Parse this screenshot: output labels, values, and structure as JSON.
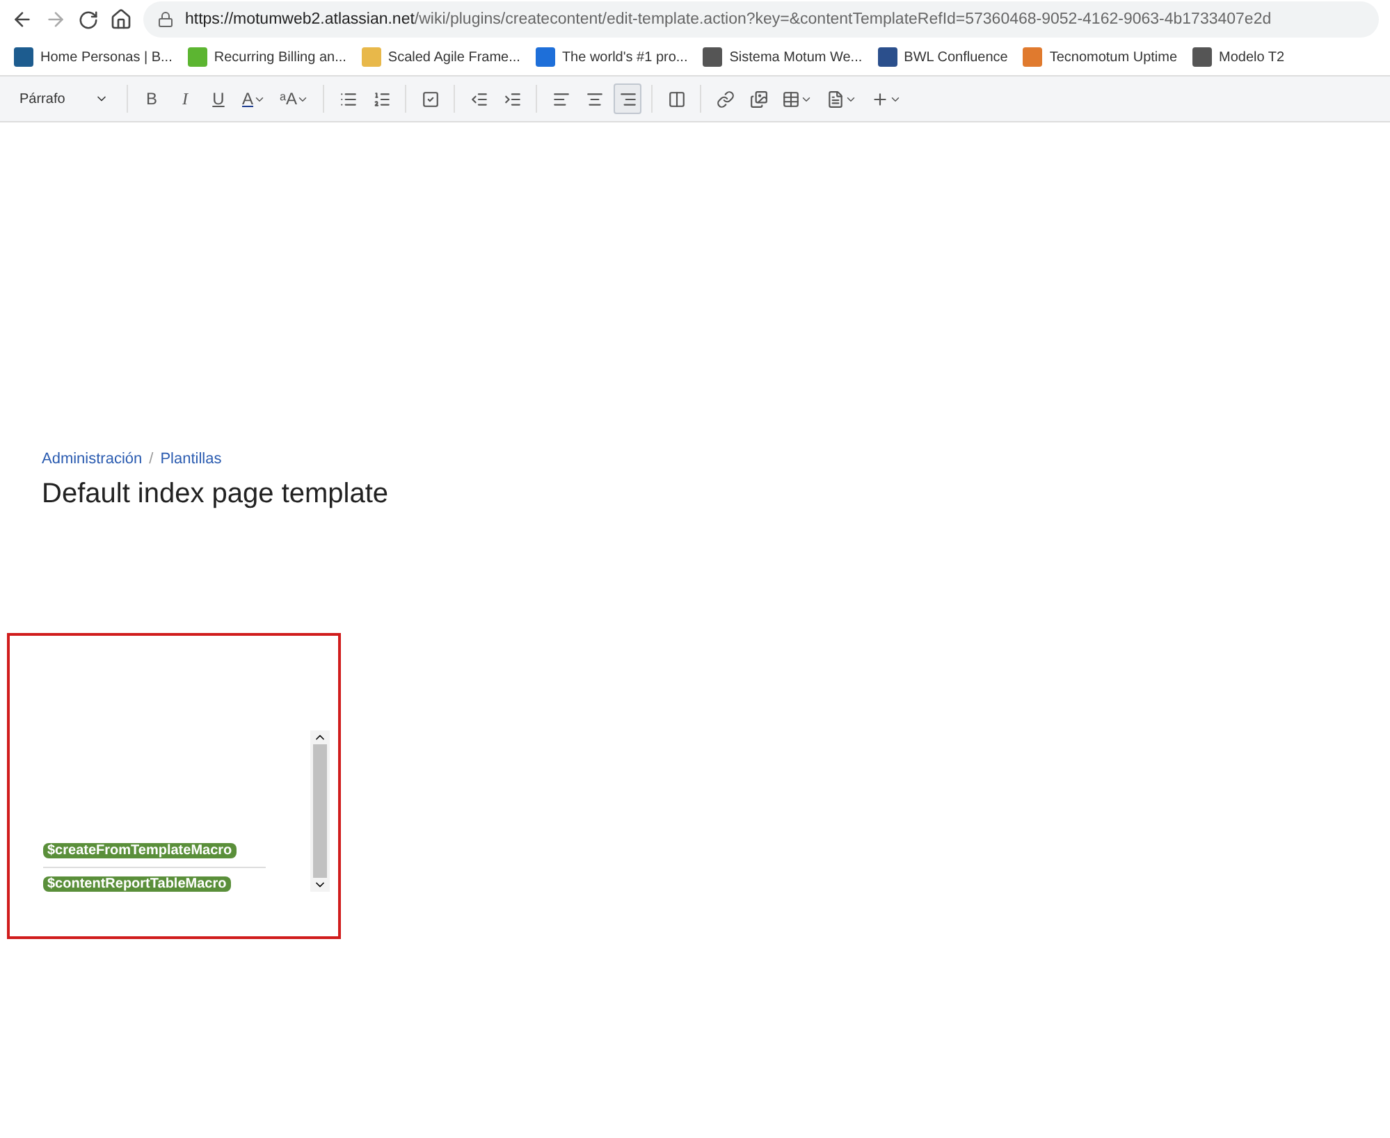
{
  "browser": {
    "url_host": "https://motumweb2.atlassian.net",
    "url_path": "/wiki/plugins/createcontent/edit-template.action?key=&contentTemplateRefId=57360468-9052-4162-9063-4b1733407e2d"
  },
  "bookmarks": [
    {
      "label": "Home Personas | B...",
      "color": "#1d5c8f"
    },
    {
      "label": "Recurring Billing an...",
      "color": "#5cb531"
    },
    {
      "label": "Scaled Agile Frame...",
      "color": "#e8b84a"
    },
    {
      "label": "The world's #1 pro...",
      "color": "#1e6fd9"
    },
    {
      "label": "Sistema Motum We...",
      "color": "#555555"
    },
    {
      "label": "BWL Confluence",
      "color": "#2b4f8c"
    },
    {
      "label": "Tecnomotum Uptime",
      "color": "#e07a2e"
    },
    {
      "label": "Modelo T2",
      "color": "#555555"
    }
  ],
  "toolbar": {
    "paragraph_style": "Párrafo",
    "buttons": [
      {
        "kind": "bold",
        "label": "B",
        "selected": false
      },
      {
        "kind": "italic",
        "label": "I",
        "selected": false
      },
      {
        "kind": "underline",
        "label": "U",
        "selected": false
      },
      {
        "kind": "color",
        "label": "A",
        "selected": false
      },
      {
        "kind": "format",
        "label": "ᵃA",
        "selected": false
      },
      {
        "kind": "sep"
      },
      {
        "kind": "bullets",
        "selected": false
      },
      {
        "kind": "numbers",
        "selected": false
      },
      {
        "kind": "sep"
      },
      {
        "kind": "task",
        "selected": false
      },
      {
        "kind": "sep"
      },
      {
        "kind": "outdent",
        "selected": false
      },
      {
        "kind": "indent",
        "selected": false
      },
      {
        "kind": "sep"
      },
      {
        "kind": "align-left",
        "selected": false
      },
      {
        "kind": "align-center",
        "selected": false
      },
      {
        "kind": "align-right",
        "selected": true
      },
      {
        "kind": "sep"
      },
      {
        "kind": "layout",
        "selected": false
      },
      {
        "kind": "sep"
      },
      {
        "kind": "link",
        "selected": false
      },
      {
        "kind": "image",
        "selected": false
      },
      {
        "kind": "table",
        "selected": false
      },
      {
        "kind": "template",
        "selected": false
      },
      {
        "kind": "insert",
        "selected": false
      }
    ]
  },
  "breadcrumbs": [
    "Administración",
    "Plantillas"
  ],
  "breadcrumb_separator": "/",
  "title": "Default index page template",
  "macros": [
    "$createFromTemplateMacro",
    "$contentReportTableMacro"
  ]
}
